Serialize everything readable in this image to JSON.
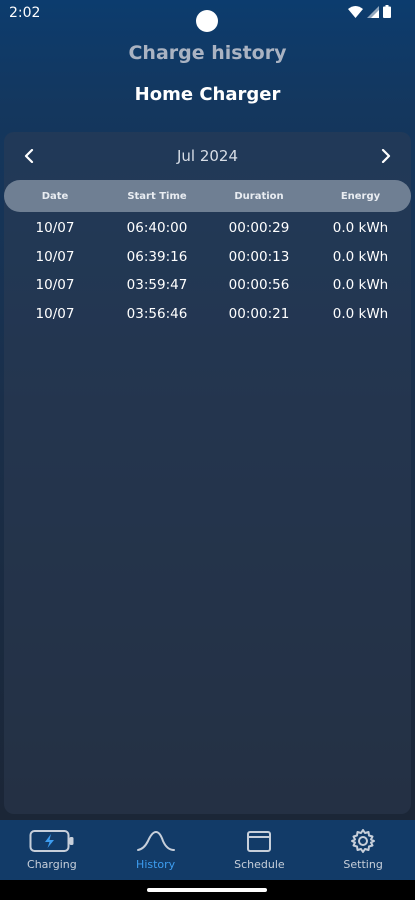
{
  "status_bar": {
    "time": "2:02",
    "icons": [
      "wifi-icon",
      "cellular-signal-icon",
      "battery-icon"
    ]
  },
  "header": {
    "title": "Charge history",
    "charger_name": "Home Charger"
  },
  "month_nav": {
    "label": "Jul 2024",
    "prev_icon": "chevron-left-icon",
    "next_icon": "chevron-right-icon"
  },
  "table": {
    "columns": [
      "Date",
      "Start Time",
      "Duration",
      "Energy"
    ],
    "rows": [
      [
        "10/07",
        "06:40:00",
        "00:00:29",
        "0.0 kWh"
      ],
      [
        "10/07",
        "06:39:16",
        "00:00:13",
        "0.0 kWh"
      ],
      [
        "10/07",
        "03:59:47",
        "00:00:56",
        "0.0 kWh"
      ],
      [
        "10/07",
        "03:56:46",
        "00:00:21",
        "0.0 kWh"
      ]
    ]
  },
  "bottom_nav": {
    "active": "History",
    "items": [
      {
        "label": "Charging",
        "icon": "battery-charging-icon"
      },
      {
        "label": "History",
        "icon": "wave-icon"
      },
      {
        "label": "Schedule",
        "icon": "calendar-icon"
      },
      {
        "label": "Setting",
        "icon": "gear-icon"
      }
    ]
  },
  "colors": {
    "accent": "#3d9df0",
    "nav_background": "#123b68",
    "table_header": "#6f7f93"
  }
}
